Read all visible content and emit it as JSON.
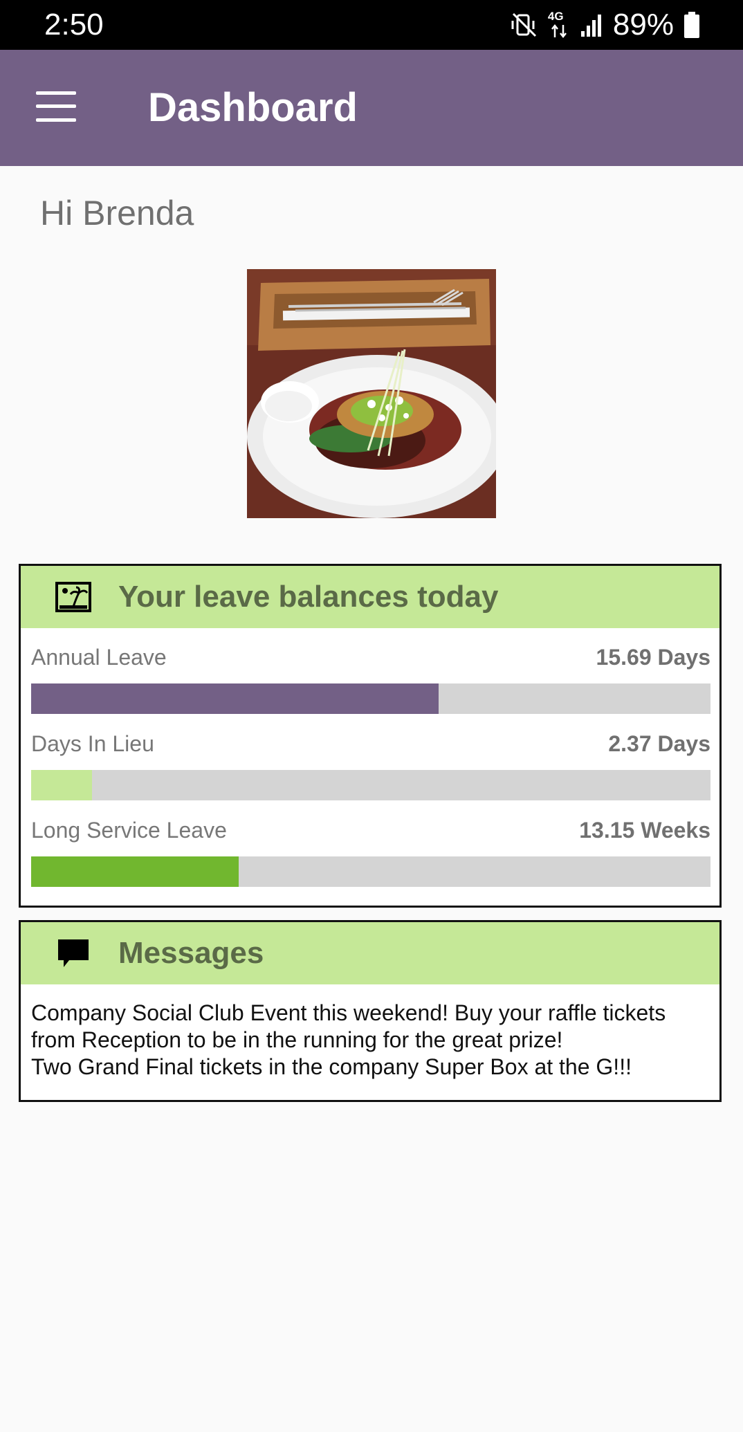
{
  "status_bar": {
    "time": "2:50",
    "network": "4G",
    "battery": "89%",
    "icons": [
      "mute-vibrate-icon",
      "network-4g-icon",
      "signal-icon",
      "battery-icon"
    ]
  },
  "app_bar": {
    "title": "Dashboard",
    "menu_icon": "hamburger-menu-icon",
    "color": "#736086"
  },
  "greeting": "Hi Brenda",
  "profile_image": "food-plate-photo",
  "leave_card": {
    "title": "Your leave balances today",
    "icon": "holiday-island-icon",
    "header_color": "#c5e897",
    "items": [
      {
        "label": "Annual Leave",
        "value": "15.69 Days",
        "fraction": 0.6,
        "color": "#736086"
      },
      {
        "label": "Days In Lieu",
        "value": "2.37 Days",
        "fraction": 0.09,
        "color": "#c5e897"
      },
      {
        "label": "Long Service Leave",
        "value": "13.15 Weeks",
        "fraction": 0.305,
        "color": "#71b72f"
      }
    ]
  },
  "messages_card": {
    "title": "Messages",
    "icon": "speech-bubble-icon",
    "lines": [
      "Company Social Club Event this weekend! Buy your raffle tickets",
      "from Reception to be in the running for the great prize!",
      "Two Grand Final tickets in the company Super Box at the G!!!"
    ]
  }
}
